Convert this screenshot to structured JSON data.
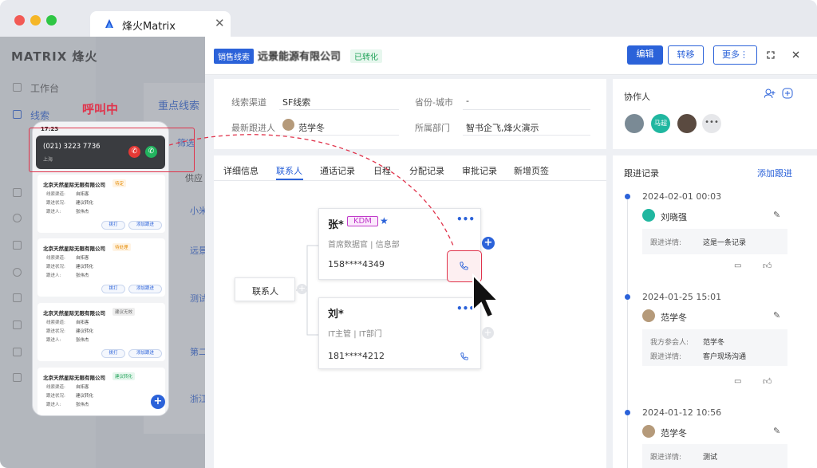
{
  "browser": {
    "tab_title": "烽火Matrix",
    "close": "✕"
  },
  "app": {
    "brand": "MATRIX 烽火",
    "sidebar": [
      "工作台",
      "线索"
    ],
    "list_title": "重点线索",
    "filter": "筛选",
    "col": "供应",
    "rows": [
      "小米",
      "远景",
      "测试",
      "第二",
      "浙江"
    ]
  },
  "header": {
    "tag": "销售线索",
    "company": "远景能源有限公司",
    "status": "已转化",
    "edit": "编辑",
    "transfer": "转移",
    "more": "更多⋮"
  },
  "info": {
    "channel_label": "线索渠道",
    "channel_value": "SF线索",
    "region_label": "省份-城市",
    "region_value": "-",
    "follower_label": "最新跟进人",
    "follower_value": "范学冬",
    "dept_label": "所属部门",
    "dept_value": "智书企飞,烽火演示"
  },
  "tabs": [
    "详细信息",
    "联系人",
    "通话记录",
    "日程",
    "分配记录",
    "审批记录",
    "新增页签"
  ],
  "contacts": {
    "root": "联系人",
    "c1": {
      "name": "张*",
      "tag": "KDM",
      "title": "首席数据官 | 信息部",
      "phone": "158****4349"
    },
    "c2": {
      "name": "刘*",
      "title": "IT主管 | IT部门",
      "phone": "181****4212"
    }
  },
  "collab": {
    "title": "协作人",
    "members": [
      "马超"
    ]
  },
  "followup": {
    "title": "跟进记录",
    "add": "添加跟进",
    "items": [
      {
        "date": "2024-02-01 00:03",
        "user": "刘晓强",
        "k1": "跟进详情:",
        "v1": "这是一条记录"
      },
      {
        "date": "2024-01-25 15:01",
        "user": "范学冬",
        "k1": "我方参会人:",
        "v1": "范学冬",
        "k2": "跟进详情:",
        "v2": "客户现场沟通"
      },
      {
        "date": "2024-01-12 10:56",
        "user": "范学冬",
        "k1": "跟进详情:",
        "v1": "测试"
      }
    ]
  },
  "phone": {
    "calling": "呼叫中",
    "time": "17:23",
    "number": "(021) 3223 7736",
    "place": "上海",
    "leads": [
      {
        "name": "北京天然星际无限有限公司",
        "badge": "待定",
        "k1": "线索渠道:",
        "v1": "自拓客",
        "k2": "跟进状况:",
        "v2": "建议转化",
        "k3": "跟进人:",
        "v3": "张伟杰",
        "a1": "拨打",
        "a2": "添加跟进"
      },
      {
        "name": "北京天然星际无限有限公司",
        "badge": "待处理",
        "k1": "线索渠道:",
        "v1": "自拓客",
        "k2": "跟进状况:",
        "v2": "建议转化",
        "k3": "跟进人:",
        "v3": "张伟杰",
        "a1": "拨打",
        "a2": "添加跟进"
      },
      {
        "name": "北京天然星际无限有限公司",
        "badge": "建议无效",
        "k1": "线索渠道:",
        "v1": "自拓客",
        "k2": "跟进状况:",
        "v2": "建议转化",
        "k3": "跟进人:",
        "v3": "张伟杰",
        "a1": "拨打",
        "a2": "添加跟进"
      },
      {
        "name": "北京天然星际无限有限公司",
        "badge": "建议转化",
        "k1": "线索渠道:",
        "v1": "自拓客",
        "k2": "跟进状况:",
        "v2": "建议转化",
        "k3": "跟进人:",
        "v3": "张伟杰"
      }
    ]
  },
  "colors": {
    "primary": "#2b62d9",
    "accent_red": "#e0334b",
    "green": "#22b35e"
  }
}
